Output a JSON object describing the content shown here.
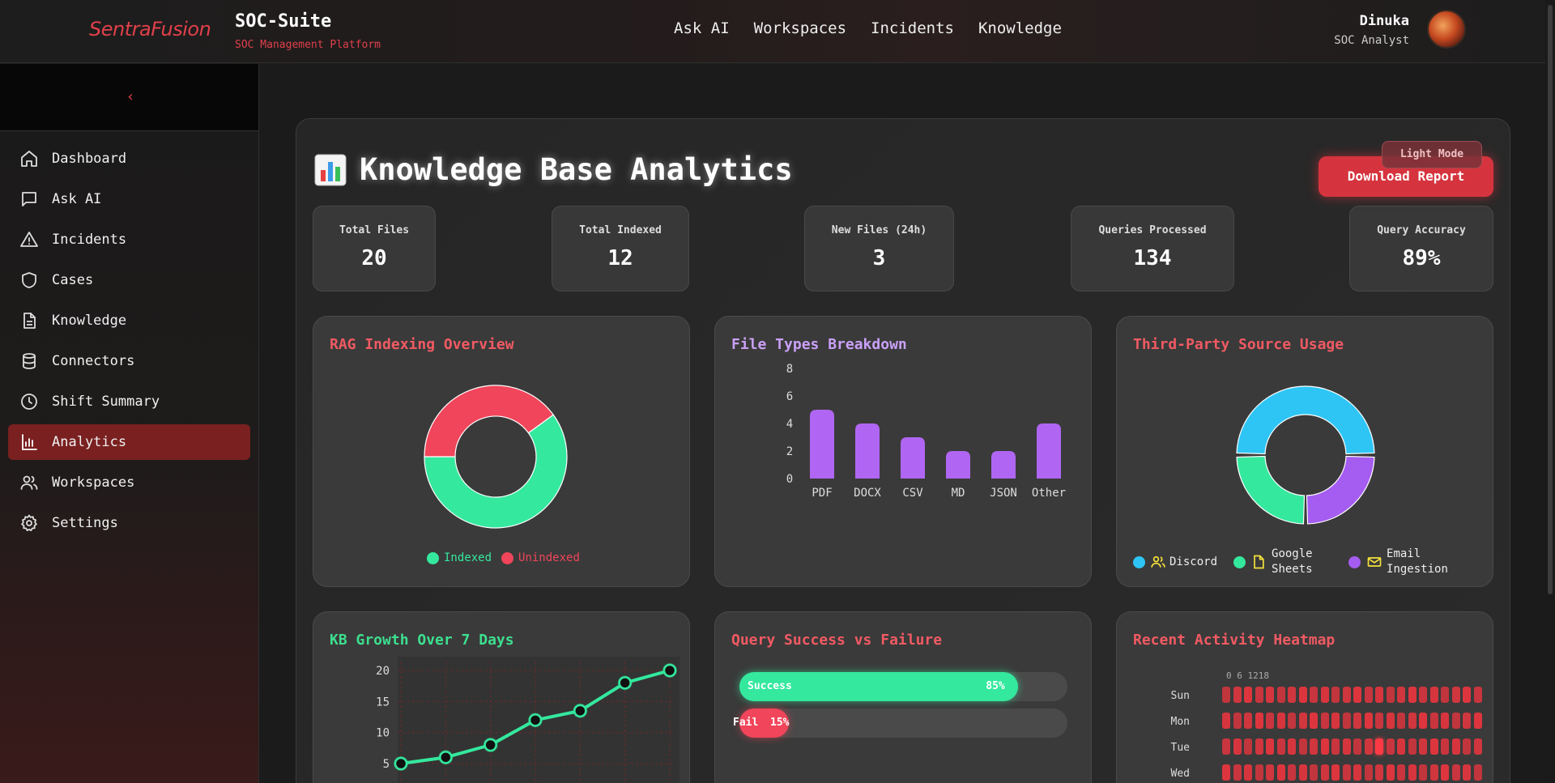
{
  "header": {
    "logo_text": "SentraFusion",
    "app_title": "SOC-Suite",
    "app_subtitle": "SOC Management Platform",
    "nav": [
      {
        "label": "Ask AI"
      },
      {
        "label": "Workspaces"
      },
      {
        "label": "Incidents"
      },
      {
        "label": "Knowledge"
      }
    ],
    "user": {
      "name": "Dinuka",
      "role": "SOC Analyst"
    }
  },
  "sidebar": {
    "collapse_icon": "chevron-left-icon",
    "items": [
      {
        "label": "Dashboard",
        "icon": "home-icon"
      },
      {
        "label": "Ask AI",
        "icon": "chat-icon"
      },
      {
        "label": "Incidents",
        "icon": "alert-icon"
      },
      {
        "label": "Cases",
        "icon": "shield-icon"
      },
      {
        "label": "Knowledge",
        "icon": "document-icon"
      },
      {
        "label": "Connectors",
        "icon": "database-icon"
      },
      {
        "label": "Shift Summary",
        "icon": "clock-icon"
      },
      {
        "label": "Analytics",
        "icon": "bar-chart-icon",
        "active": true
      },
      {
        "label": "Workspaces",
        "icon": "users-icon"
      },
      {
        "label": "Settings",
        "icon": "gear-icon"
      }
    ]
  },
  "main": {
    "title": "Knowledge Base Analytics",
    "title_icon": "bar-chart-emoji-icon",
    "light_mode_label": "Light Mode",
    "download_label": "Download Report",
    "stats": [
      {
        "label": "Total Files",
        "value": "20"
      },
      {
        "label": "Total Indexed",
        "value": "12"
      },
      {
        "label": "New Files (24h)",
        "value": "3"
      },
      {
        "label": "Queries Processed",
        "value": "134"
      },
      {
        "label": "Query Accuracy",
        "value": "89%"
      }
    ],
    "cards": {
      "rag": {
        "title": "RAG Indexing Overview",
        "legend": [
          "Indexed",
          "Unindexed"
        ]
      },
      "filetypes": {
        "title": "File Types Breakdown"
      },
      "sources": {
        "title": "Third-Party Source Usage",
        "legend": [
          "Discord",
          "Google Sheets",
          "Email Ingestion"
        ]
      },
      "growth": {
        "title": "KB Growth Over 7 Days"
      },
      "query": {
        "title": "Query Success vs Failure",
        "success_label": "Success",
        "success_value": "85%",
        "fail_label": "Fail",
        "fail_value": "15%"
      },
      "heatmap": {
        "title": "Recent Activity Heatmap",
        "hours_label": "0 6 1218",
        "days": [
          "Sun",
          "Mon",
          "Tue",
          "Wed"
        ]
      }
    }
  },
  "colors": {
    "accent": "#e0404a",
    "indexed": "#34e89e",
    "unindexed": "#f0455a",
    "bar": "#b066f2",
    "discord": "#2ec5f5",
    "sheets": "#34e89e",
    "email": "#a55cf0",
    "heat": "#e8353f"
  },
  "chart_data": [
    {
      "type": "pie",
      "title": "RAG Indexing Overview",
      "labels": [
        "Indexed",
        "Unindexed"
      ],
      "values": [
        12,
        8
      ]
    },
    {
      "type": "bar",
      "title": "File Types Breakdown",
      "categories": [
        "PDF",
        "DOCX",
        "CSV",
        "MD",
        "JSON",
        "Other"
      ],
      "values": [
        5,
        4,
        3,
        2,
        2,
        4
      ],
      "yticks": [
        "0",
        "2",
        "4",
        "6",
        "8"
      ],
      "ylim": [
        0,
        8
      ]
    },
    {
      "type": "pie",
      "title": "Third-Party Source Usage",
      "labels": [
        "Discord",
        "Google Sheets",
        "Email Ingestion"
      ],
      "values": [
        50,
        25,
        25
      ]
    },
    {
      "type": "line",
      "title": "KB Growth Over 7 Days",
      "x": [
        1,
        2,
        3,
        4,
        5,
        6,
        7
      ],
      "values": [
        5,
        6,
        8,
        12,
        13.5,
        18,
        20
      ],
      "yticks": [
        "5",
        "10",
        "15",
        "20"
      ]
    },
    {
      "type": "bar",
      "title": "Query Success vs Failure",
      "categories": [
        "Success",
        "Fail"
      ],
      "values": [
        85,
        15
      ]
    },
    {
      "type": "heatmap",
      "title": "Recent Activity Heatmap",
      "rows": [
        "Sun",
        "Mon",
        "Tue",
        "Wed"
      ],
      "columns": 24,
      "highlight": {
        "row": "Tue",
        "column": 14
      }
    }
  ]
}
